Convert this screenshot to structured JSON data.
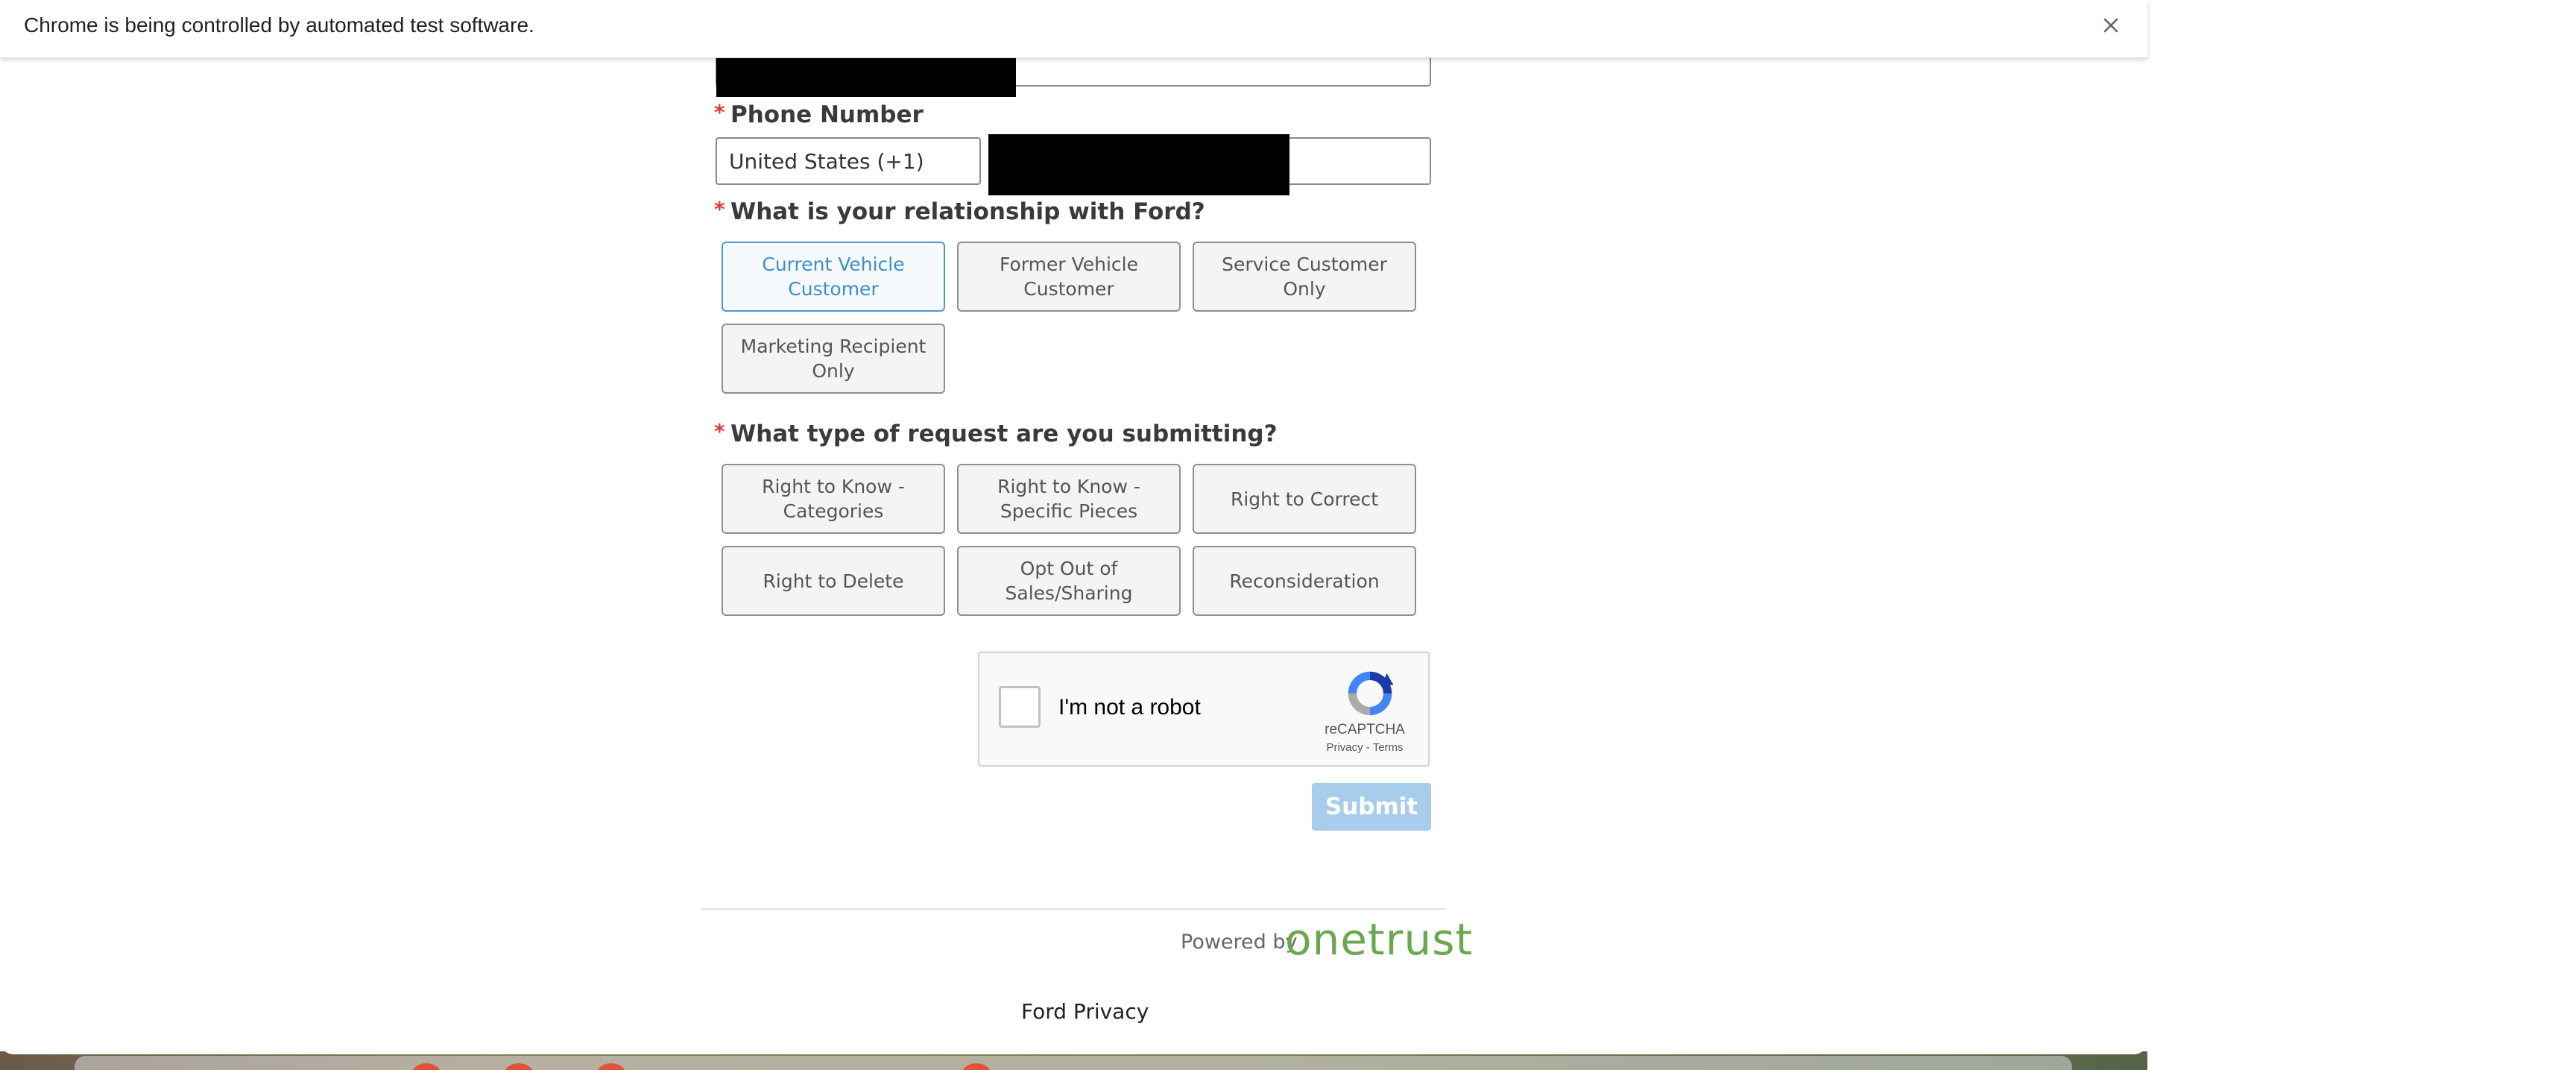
{
  "infobar": {
    "message": "Chrome is being controlled by automated test software.",
    "close_icon": "close-icon"
  },
  "form": {
    "phone": {
      "label": "Phone Number",
      "required_mark": "*",
      "country_value": "United States (+1)",
      "number_value": ""
    },
    "relationship": {
      "label": "What is your relationship with Ford?",
      "required_mark": "*",
      "options": [
        {
          "label": "Current Vehicle Customer",
          "selected": true
        },
        {
          "label": "Former Vehicle Customer",
          "selected": false
        },
        {
          "label": "Service Customer Only",
          "selected": false
        },
        {
          "label": "Marketing Recipient Only",
          "selected": false
        }
      ]
    },
    "request_type": {
      "label": "What type of request are you submitting?",
      "required_mark": "*",
      "options": [
        {
          "label": "Right to Know - Categories"
        },
        {
          "label": "Right to Know - Specific Pieces"
        },
        {
          "label": "Right to Correct"
        },
        {
          "label": "Right to Delete"
        },
        {
          "label": "Opt Out of Sales/Sharing"
        },
        {
          "label": "Reconsideration"
        }
      ]
    },
    "recaptcha": {
      "label": "I'm not a robot",
      "brand": "reCAPTCHA",
      "privacy_link": "Privacy",
      "separator": " - ",
      "terms_link": "Terms"
    },
    "submit_label": "Submit"
  },
  "footer": {
    "powered_by": "Powered by",
    "brand": "onetrust",
    "privacy_link": "Ford Privacy"
  },
  "colors": {
    "accent": "#4a9ad6",
    "required": "#e2363a",
    "submit_disabled": "#a8cdec",
    "onetrust_green": "#6aa84f"
  }
}
